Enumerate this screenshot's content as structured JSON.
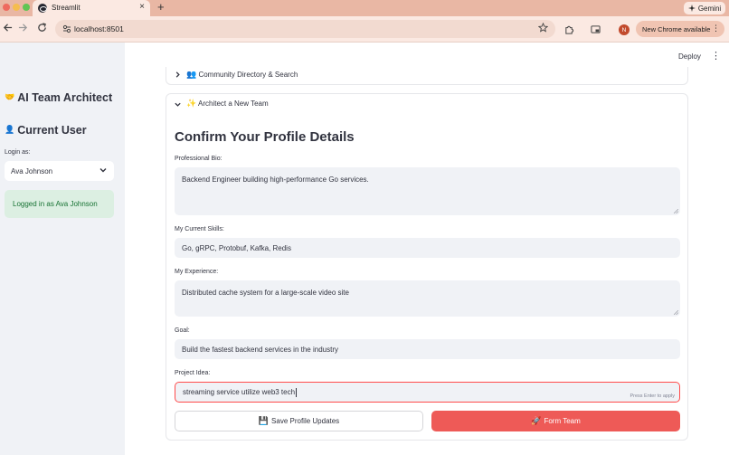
{
  "browser": {
    "tab_title": "Streamlit",
    "tab_close": "×",
    "new_tab": "+",
    "gemini_label": "Gemini",
    "url": "localhost:8501",
    "profile_initial": "N",
    "update_label": "New Chrome available",
    "icons": {
      "back": "arrow-left-icon",
      "forward": "arrow-right-icon",
      "reload": "reload-icon",
      "star": "star-icon",
      "extensions": "puzzle-icon",
      "cast": "cast-icon"
    }
  },
  "sidebar": {
    "title_emoji": "🤝",
    "title": "AI Team Architect",
    "user_emoji": "👤",
    "user_heading": "Current User",
    "login_label": "Login as:",
    "login_value": "Ava Johnson",
    "status_text": "Logged in as Ava Johnson"
  },
  "header": {
    "deploy_label": "Deploy",
    "menu_glyph": "⋮"
  },
  "expanders": {
    "directory": {
      "emoji": "👥",
      "label": "Community Directory & Search"
    },
    "architect": {
      "emoji": "✨",
      "label": "Architect a New Team"
    }
  },
  "form": {
    "title": "Confirm Your Profile Details",
    "bio_label": "Professional Bio:",
    "bio_value": "Backend Engineer building high-performance Go services.",
    "skills_label": "My Current Skills:",
    "skills_value": "Go, gRPC, Protobuf, Kafka, Redis",
    "experience_label": "My Experience:",
    "experience_value": "Distributed cache system for a large-scale video site",
    "goal_label": "Goal:",
    "goal_value": "Build the fastest backend services in the industry",
    "idea_label": "Project Idea:",
    "idea_value": "streaming service utilize web3 tech",
    "enter_hint": "Press Enter to apply",
    "save_emoji": "💾",
    "save_label": "Save Profile Updates",
    "form_emoji": "🚀",
    "form_label": "Form Team"
  },
  "colors": {
    "primary": "#ff4b4b",
    "button_primary": "#ee5a57",
    "sidebar_bg": "#f0f2f6",
    "success_bg": "#dcefe2",
    "success_text": "#177233",
    "browser_accent": "#e9b7a4"
  }
}
